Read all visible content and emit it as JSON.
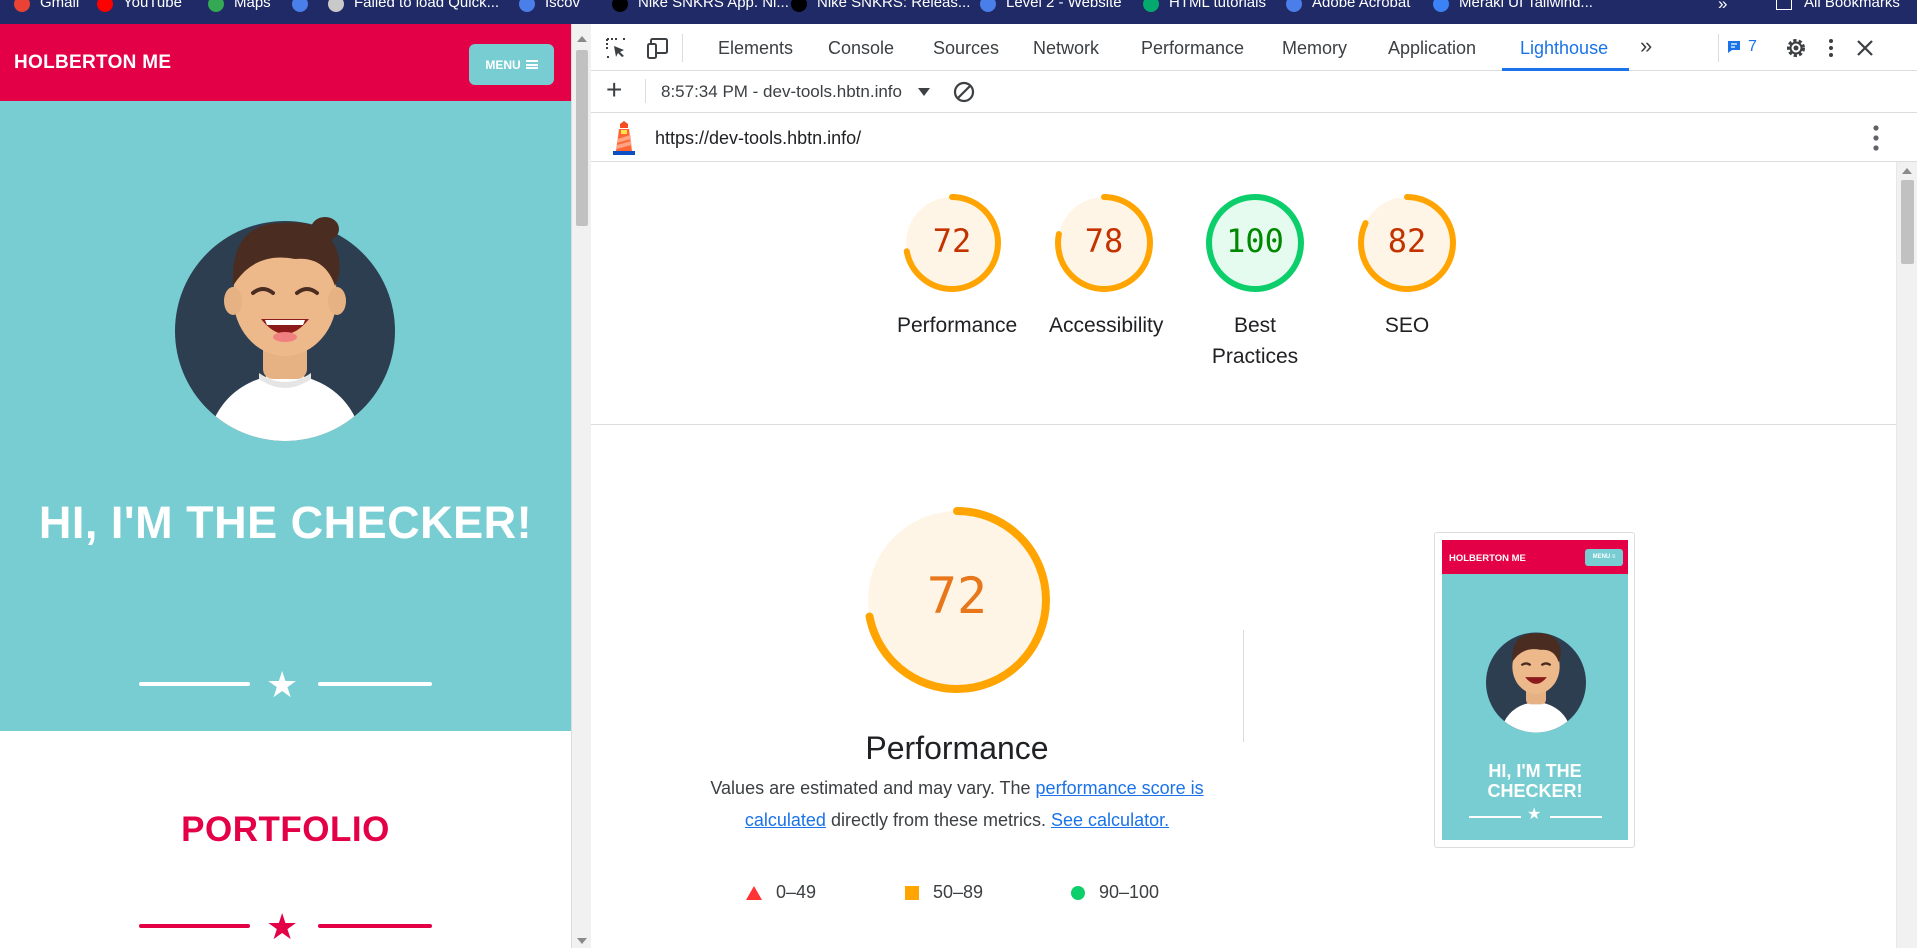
{
  "bookmarks": {
    "items": [
      {
        "label": "Gmail",
        "icon": "gmail-icon",
        "color": "#ea4335"
      },
      {
        "label": "YouTube",
        "icon": "youtube-icon",
        "color": "#ff0000"
      },
      {
        "label": "Maps",
        "icon": "maps-icon",
        "color": "#34a853"
      },
      {
        "label": "",
        "icon": "globe-icon",
        "color": "#4a7ee8"
      },
      {
        "label": "Failed to load Quick...",
        "icon": "page-icon",
        "color": "#c9c9c9"
      },
      {
        "label": "Iscov",
        "icon": "globe-icon",
        "color": "#4a7ee8"
      },
      {
        "label": "Nike SNKRS App. Ni...",
        "icon": "nike-icon",
        "color": "#000000"
      },
      {
        "label": "Nike SNKRS: Releas...",
        "icon": "nike-icon",
        "color": "#000000"
      },
      {
        "label": "Level 2 - Website",
        "icon": "globe-icon",
        "color": "#4a7ee8"
      },
      {
        "label": "HTML tutorials",
        "icon": "w3-icon",
        "color": "#04aa6d"
      },
      {
        "label": "Adobe Acrobat",
        "icon": "globe-icon",
        "color": "#4a7ee8"
      },
      {
        "label": "Meraki UI Tailwind...",
        "icon": "meraki-icon",
        "color": "#3b82f6"
      }
    ],
    "more": "»",
    "all_bookmarks": "All Bookmarks"
  },
  "site": {
    "brand": "HOLBERTON ME",
    "menu_label": "MENU",
    "hero_title": "HI, I'M THE CHECKER!",
    "portfolio_title": "PORTFOLIO",
    "colors": {
      "primary": "#e40046",
      "hero_bg": "#78cdd2"
    }
  },
  "devtools": {
    "tabs": [
      "Elements",
      "Console",
      "Sources",
      "Network",
      "Performance",
      "Memory",
      "Application",
      "Lighthouse"
    ],
    "active_tab": "Lighthouse",
    "more_tabs": "»",
    "message_count": "7",
    "toolbar": {
      "add_label": "+",
      "report_select": "8:57:34 PM - dev-tools.hbtn.info"
    },
    "url": "https://dev-tools.hbtn.info/"
  },
  "lighthouse": {
    "summary": [
      {
        "label": "Performance",
        "score": "72",
        "band": "average"
      },
      {
        "label": "Accessibility",
        "score": "78",
        "band": "average"
      },
      {
        "label": "Best Practices",
        "score": "100",
        "band": "pass"
      },
      {
        "label": "SEO",
        "score": "82",
        "band": "average"
      }
    ],
    "performance": {
      "score": "72",
      "title": "Performance",
      "desc_part1": "Values are estimated and may vary. The ",
      "desc_link1": "performance score is calculated",
      "desc_part2": " directly from these metrics. ",
      "desc_link2": "See calculator."
    },
    "legend": [
      {
        "range": "0–49",
        "shape": "triangle",
        "color": "#ff3333"
      },
      {
        "range": "50–89",
        "shape": "square",
        "color": "#ffa400"
      },
      {
        "range": "90–100",
        "shape": "circle",
        "color": "#0cce6b"
      }
    ],
    "thumbnail": {
      "brand": "HOLBERTON ME",
      "menu": "MENU ≡",
      "title": "HI, I'M THE CHECKER!"
    },
    "colors": {
      "average": "#ffa400",
      "average_text": "#c33300",
      "pass": "#0cce6b",
      "pass_text": "#008800",
      "average_bg": "#fff5e6",
      "pass_bg": "#e6fbef"
    }
  }
}
